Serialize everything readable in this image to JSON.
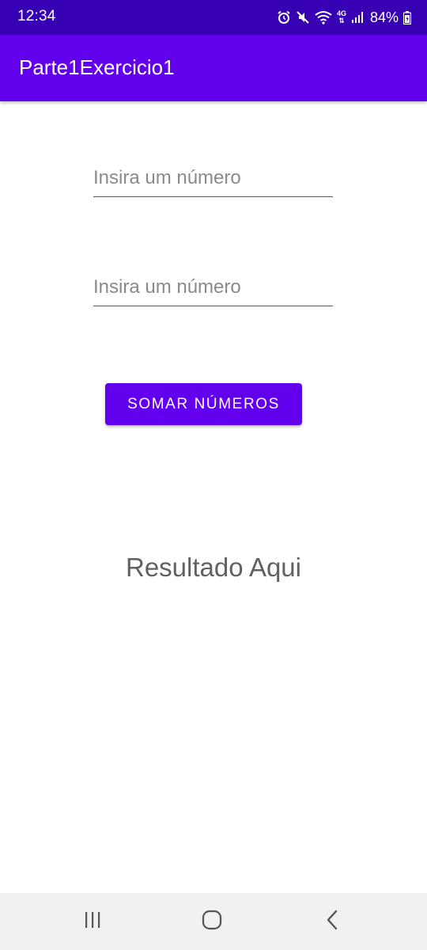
{
  "status_bar": {
    "time": "12:34",
    "network_label": "4G",
    "battery": "84%",
    "icons": [
      "alarm-icon",
      "mute-icon",
      "wifi-icon",
      "network-4g-icon",
      "signal-icon",
      "battery-icon"
    ]
  },
  "app_bar": {
    "title": "Parte1Exercicio1"
  },
  "form": {
    "input1": {
      "placeholder": "Insira um número",
      "value": ""
    },
    "input2": {
      "placeholder": "Insira um número",
      "value": ""
    },
    "button_label": "SOMAR NÚMEROS"
  },
  "result": {
    "text": "Resultado Aqui"
  },
  "nav_bar": {
    "buttons": [
      "recent-apps-icon",
      "home-icon",
      "back-icon"
    ]
  },
  "colors": {
    "status_bar": "#3700b3",
    "primary": "#6200ee",
    "result_text": "#616161",
    "nav_bar": "#f1f1f1"
  }
}
